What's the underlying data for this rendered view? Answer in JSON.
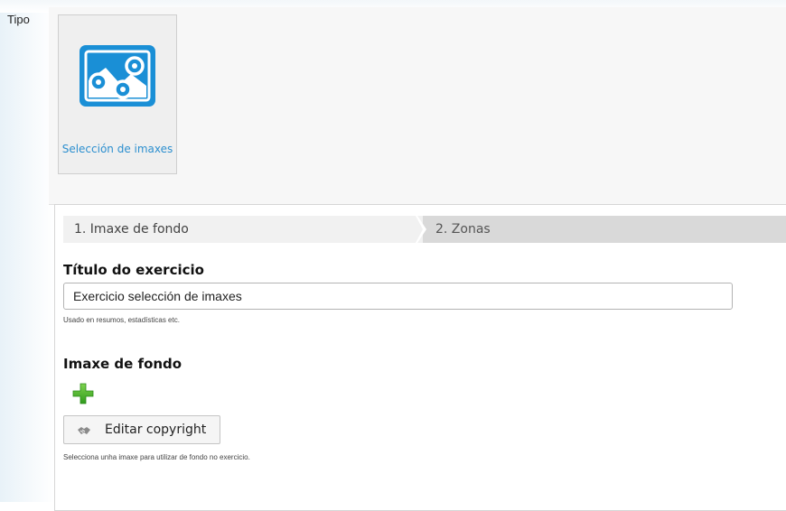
{
  "type_section": {
    "label": "Tipo",
    "selected_type": {
      "name": "Selección de imaxes",
      "icon": "image-selection-icon",
      "icon_color": "#1a8fd6"
    }
  },
  "wizard": {
    "steps": [
      {
        "label": "1. Imaxe de fondo",
        "active": true
      },
      {
        "label": "2. Zonas",
        "active": false
      }
    ]
  },
  "exercise_title": {
    "label": "Título do exercicio",
    "value": "Exercicio selección de imaxes",
    "help": "Usado en resumos, estadísticas etc."
  },
  "background_image": {
    "label": "Imaxe de fondo",
    "add_icon": "add-icon",
    "copyright_button": "Editar copyright",
    "help": "Selecciona unha imaxe para utilizar de fondo no exercicio."
  }
}
